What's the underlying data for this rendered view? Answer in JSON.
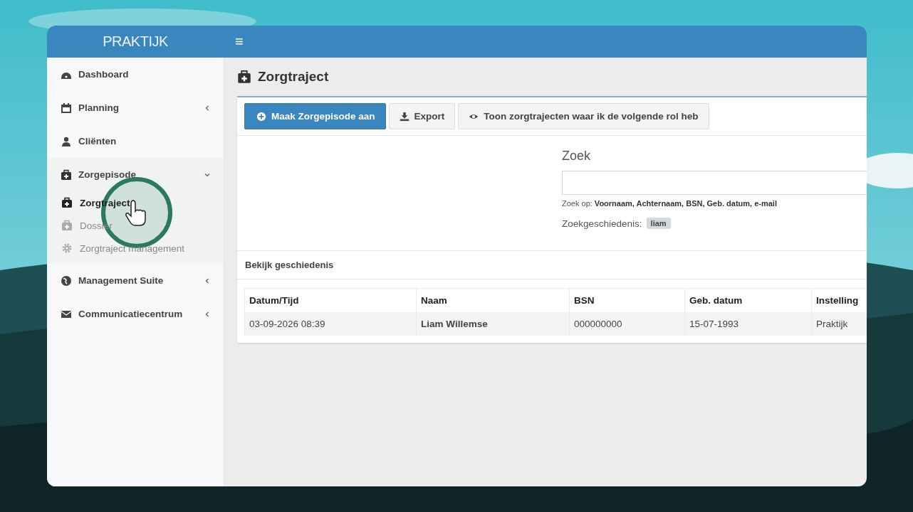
{
  "brand": "PRAKTIJK",
  "menu_icon": "≡",
  "sidebar": {
    "items": [
      {
        "label": "Dashboard",
        "kind": "link"
      },
      {
        "label": "Planning",
        "kind": "menu",
        "expanded": false
      },
      {
        "label": "Cliënten",
        "kind": "link"
      },
      {
        "label": "Zorgepisode",
        "kind": "menu",
        "expanded": true,
        "children": [
          {
            "label": "Zorgtraject",
            "selected": true
          },
          {
            "label": "Dossier",
            "selected": false
          },
          {
            "label": "Zorgtraject management",
            "selected": false
          }
        ]
      },
      {
        "label": "Management Suite",
        "kind": "menu",
        "expanded": false
      },
      {
        "label": "Communicatiecentrum",
        "kind": "menu",
        "expanded": false
      }
    ]
  },
  "page_title": "Zorgtraject",
  "toolbar": [
    {
      "label": "Maak Zorgepisode aan",
      "kind": "primary"
    },
    {
      "label": "Export",
      "kind": "default"
    },
    {
      "label": "Toon zorgtrajecten waar ik de volgende rol heb",
      "kind": "default"
    }
  ],
  "search": {
    "label": "Zoek",
    "hint": "Zoek op: **Voornaam, Achternaam, BSN, Geb. datum, e-mail**",
    "history_label": "Zoekgeschiedenis:",
    "history": [
      "liam"
    ]
  },
  "history_section": {
    "title": "Bekijk geschiedenis",
    "table": {
      "columns": [
        "Datum/Tijd",
        "Naam",
        "BSN",
        "Geb. datum",
        "Instelling"
      ],
      "rows": [
        [
          "03-09-2026 08:39",
          "Liam Willemse",
          "000000000",
          "15-07-1993",
          "Praktijk"
        ]
      ]
    }
  }
}
